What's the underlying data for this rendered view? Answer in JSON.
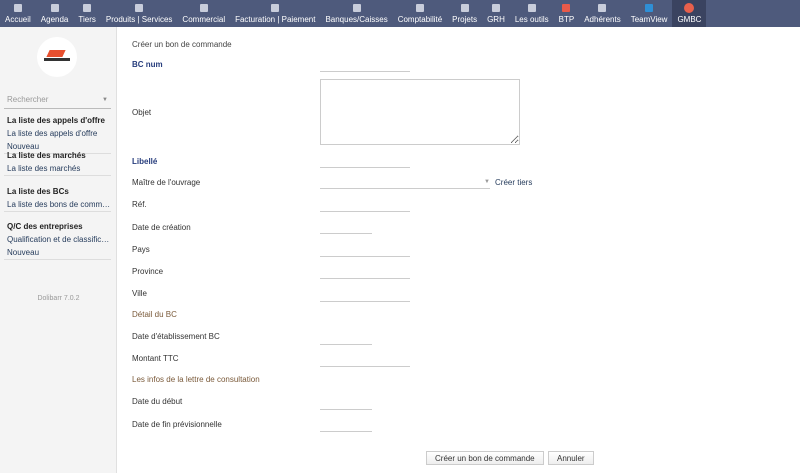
{
  "topnav": [
    {
      "label": "Accueil",
      "icon": "home-icon"
    },
    {
      "label": "Agenda",
      "icon": "calendar-icon"
    },
    {
      "label": "Tiers",
      "icon": "building-icon"
    },
    {
      "label": "Produits | Services",
      "icon": "cubes-icon"
    },
    {
      "label": "Commercial",
      "icon": "suitcase-icon"
    },
    {
      "label": "Facturation | Paiement",
      "icon": "invoice-icon"
    },
    {
      "label": "Banques/Caisses",
      "icon": "bank-icon"
    },
    {
      "label": "Comptabilité",
      "icon": "accounting-icon"
    },
    {
      "label": "Projets",
      "icon": "project-icon"
    },
    {
      "label": "GRH",
      "icon": "hr-icon"
    },
    {
      "label": "Les outils",
      "icon": "tools-icon"
    },
    {
      "label": "BTP",
      "icon": "btp-icon"
    },
    {
      "label": "Adhérents",
      "icon": "members-icon"
    },
    {
      "label": "TeamView",
      "icon": "team-icon"
    },
    {
      "label": "GMBC",
      "icon": "gmbc-icon",
      "active": true
    }
  ],
  "sidebar": {
    "search_placeholder": "Rechercher",
    "menus": [
      {
        "title": "La liste des appels d'offre",
        "items": [
          "La liste des appels d'offre",
          "Nouveau"
        ]
      },
      {
        "title": "La liste des marchés",
        "items": [
          "La liste des marchés"
        ]
      },
      {
        "title": "La liste des BCs",
        "items": [
          "La liste des bons de commandes"
        ]
      },
      {
        "title": "Q/C des entreprises",
        "items": [
          "Qualification et de classification",
          "Nouveau"
        ]
      }
    ],
    "version": "Dolibarr 7.0.2"
  },
  "form": {
    "title": "Créer un bon de commande",
    "create_tiers": "Créer tiers",
    "submit": "Créer un bon de commande",
    "cancel": "Annuler",
    "rows": [
      {
        "label": "BC num",
        "type": "bold"
      },
      {
        "label": "Objet",
        "type": "plain"
      },
      {
        "label": "Libellé",
        "type": "bold"
      },
      {
        "label": "Maître de l'ouvrage",
        "type": "plain"
      },
      {
        "label": "Réf.",
        "type": "plain"
      },
      {
        "label": "Date de création",
        "type": "plain"
      },
      {
        "label": "Pays",
        "type": "plain"
      },
      {
        "label": "Province",
        "type": "plain"
      },
      {
        "label": "Ville",
        "type": "plain"
      },
      {
        "label": "Détail du BC",
        "type": "section"
      },
      {
        "label": "Date d'établissement BC",
        "type": "plain"
      },
      {
        "label": "Montant TTC",
        "type": "plain"
      },
      {
        "label": "Les infos de la lettre de consultation",
        "type": "section"
      },
      {
        "label": "Date du début",
        "type": "plain"
      },
      {
        "label": "Date de fin prévisionnelle",
        "type": "plain"
      }
    ]
  }
}
